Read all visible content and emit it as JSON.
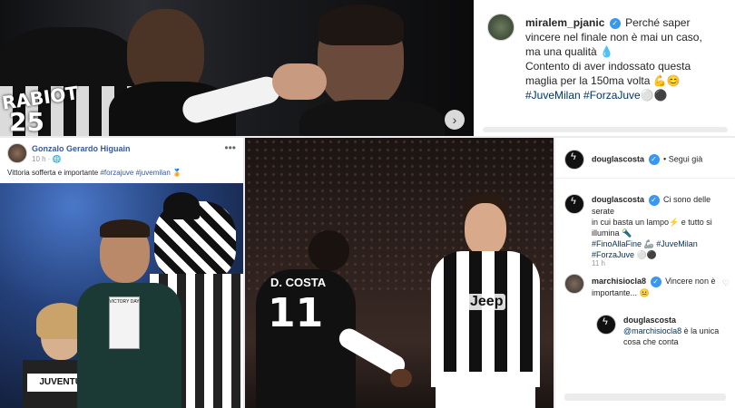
{
  "top_photo": {
    "jersey_name": "RABIOT",
    "jersey_number": "25",
    "next_icon": "chevron-right-icon"
  },
  "ig_top": {
    "username": "miralem_pjanic",
    "caption_lines": [
      "Perché saper",
      "vincere nel finale non è mai un caso,",
      "ma una qualità 💧",
      "Contento di aver indossato questa",
      "maglia per la 150ma volta 💪😊"
    ],
    "hashtags": "#JuveMilan #ForzaJuve⚪⚫",
    "accent": "#3897f0"
  },
  "facebook": {
    "author": "Gonzalo Gerardo Higuain",
    "time": "10 h · 🌐",
    "text": "Vittoria sofferta e importante",
    "hashtags": "#forzajuve #juvemilan 🏅",
    "more_icon": "more-dots-icon",
    "sign_text": "JUVENTUS",
    "card_text": "VICTORY DAY"
  },
  "mid_photo": {
    "left_player_name": "D. COSTA",
    "left_player_number": "11",
    "sponsor": "Jeep"
  },
  "ig_right": {
    "header_user": "douglascosta",
    "follow_label": "• Segui già",
    "caption_user": "douglascosta",
    "caption_lines": [
      "Ci sono delle serate",
      "in cui basta un lampo⚡ e tutto si",
      "illumina 🔦"
    ],
    "caption_tags_lines": [
      "#FinoAllaFine 🦾 #JuveMilan",
      "#ForzaJuve ⚪⚫"
    ],
    "time": "11 h",
    "comment_user": "marchisiocla8",
    "comment_text": "Vincere non è",
    "comment_text2": "importante... 😐",
    "reply_user": "douglascosta",
    "reply_mention": "@marchisiocla8",
    "reply_text": "è la unica",
    "reply_text2": "cosa che conta"
  }
}
